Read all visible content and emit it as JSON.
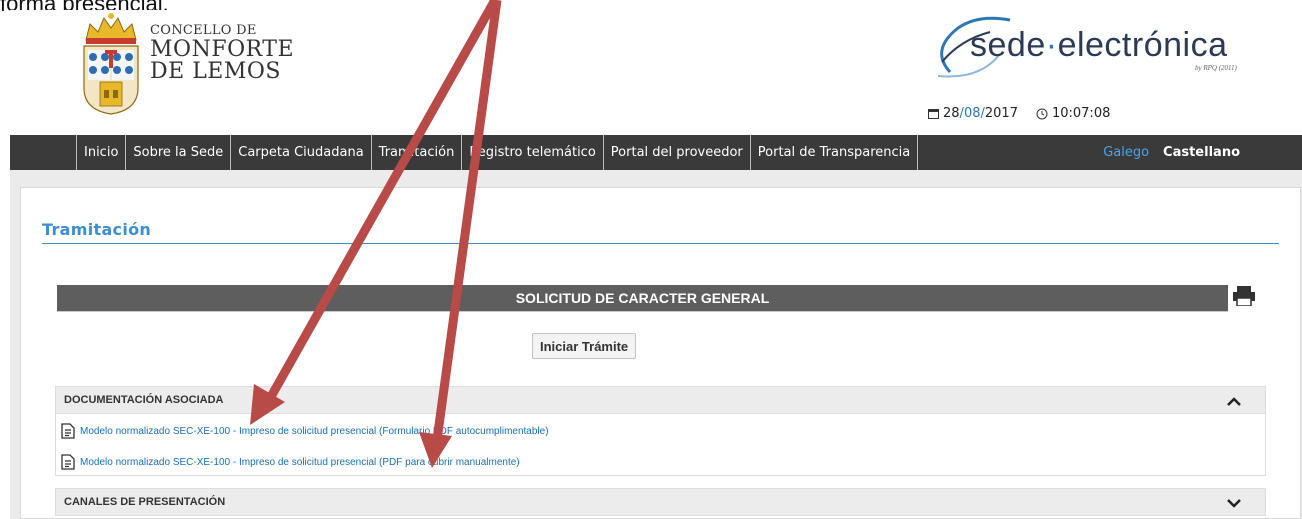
{
  "caption_fragment": "forma presencial.",
  "header": {
    "municipality_line1": "CONCELLO DE",
    "municipality_line2": "MONFORTE",
    "municipality_line3": "DE LEMOS",
    "sede_logo_main": "sede",
    "sede_logo_dot": "·",
    "sede_logo_tail": "electrónica",
    "sede_logo_sub": "by RPQ (2011)",
    "date_day": "28",
    "date_month": "08",
    "date_year": "2017",
    "time": "10:07:08"
  },
  "nav": {
    "items": [
      {
        "label": "Inicio"
      },
      {
        "label": "Sobre la Sede"
      },
      {
        "label": "Carpeta Ciudadana"
      },
      {
        "label": "Tramitación"
      },
      {
        "label": "Registro telemático"
      },
      {
        "label": "Portal del proveedor"
      },
      {
        "label": "Portal de Transparencia"
      }
    ],
    "lang_galego": "Galego",
    "lang_castellano": "Castellano"
  },
  "main": {
    "section_title": "Tramitación",
    "procedure_title": "SOLICITUD DE CARACTER GENERAL",
    "start_button": "Iniciar Trámite",
    "documentation_header": "DOCUMENTACIÓN ASOCIADA",
    "documents": [
      {
        "label": "Modelo normalizado SEC-XE-100 - Impreso de solicitud presencial (Formulario PDF autocumplimentable)"
      },
      {
        "label": "Modelo normalizado SEC-XE-100 - Impreso de solicitud presencial (PDF para cubrir manualmente)"
      }
    ],
    "channels_header": "CANALES DE PRESENTACIÓN"
  },
  "colors": {
    "navbar": "#3a3a3a",
    "accent_blue": "#3b8fd6",
    "link_blue": "#1a6fb8",
    "annotation_arrow": "#b84a47"
  }
}
